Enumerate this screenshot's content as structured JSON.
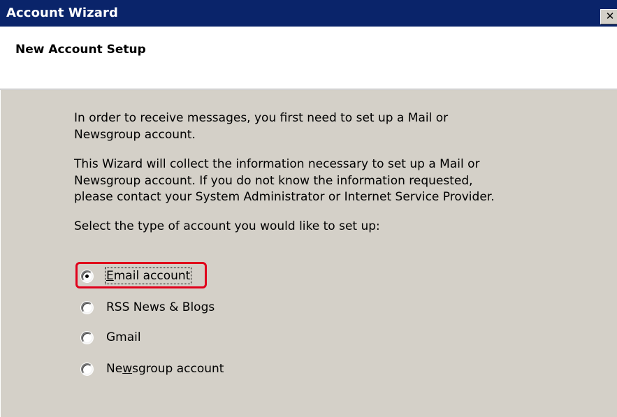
{
  "window": {
    "title": "Account Wizard",
    "close_glyph": "✕"
  },
  "header": {
    "title": "New Account Setup"
  },
  "body": {
    "paragraph_1": "In order to receive messages, you first need to set up a Mail or\nNewsgroup account.",
    "paragraph_2": "This Wizard will collect the information necessary to set up a Mail or\nNewsgroup account. If you do not know the information requested,\nplease contact your System Administrator or Internet Service Provider.",
    "prompt": "Select the type of account you would like to set up:"
  },
  "account_types": {
    "email": {
      "label_prefix": "",
      "label_accel": "E",
      "label_rest": "mail account",
      "selected": true
    },
    "rss": {
      "label_prefix": "RSS News & Blogs",
      "label_accel": "",
      "label_rest": "",
      "selected": false
    },
    "gmail": {
      "label_prefix": "Gmail",
      "label_accel": "",
      "label_rest": "",
      "selected": false
    },
    "newsgroup": {
      "label_prefix": "Ne",
      "label_accel": "w",
      "label_rest": "sgroup account",
      "selected": false
    }
  },
  "colors": {
    "titlebar": "#0a246a",
    "dialog_background": "#d4d0c8",
    "highlight": "#e0001b"
  },
  "icons": {
    "close": "close-icon",
    "radio": "radio-button-icon"
  }
}
